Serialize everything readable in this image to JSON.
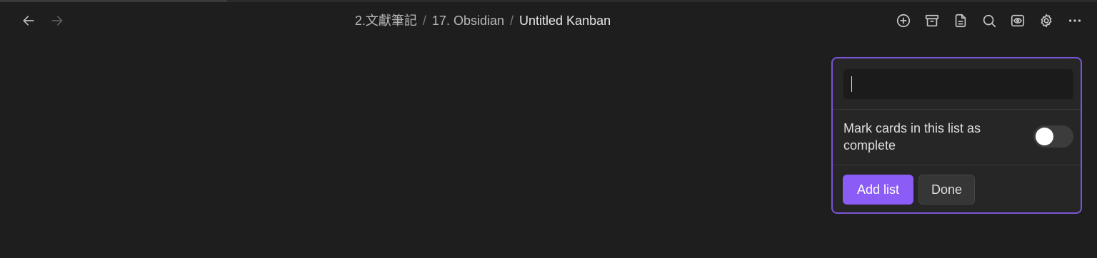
{
  "header": {
    "breadcrumb": [
      {
        "label": "2.文獻筆記"
      },
      {
        "label": "17. Obsidian"
      },
      {
        "label": "Untitled Kanban"
      }
    ],
    "separator": "/",
    "nav": {
      "back_icon": "arrow-left-icon",
      "forward_icon": "arrow-right-icon"
    },
    "actions": [
      {
        "icon": "plus-circle-icon"
      },
      {
        "icon": "archive-icon"
      },
      {
        "icon": "document-icon"
      },
      {
        "icon": "search-icon"
      },
      {
        "icon": "eye-icon"
      },
      {
        "icon": "gear-icon"
      },
      {
        "icon": "more-horizontal-icon"
      }
    ]
  },
  "add_list_form": {
    "title_value": "",
    "mark_complete_label": "Mark cards in this list as complete",
    "mark_complete_on": false,
    "add_label": "Add list",
    "done_label": "Done"
  },
  "colors": {
    "background": "#1e1e1e",
    "accent": "#8b5cf6",
    "panel_border": "#7a55d6"
  }
}
